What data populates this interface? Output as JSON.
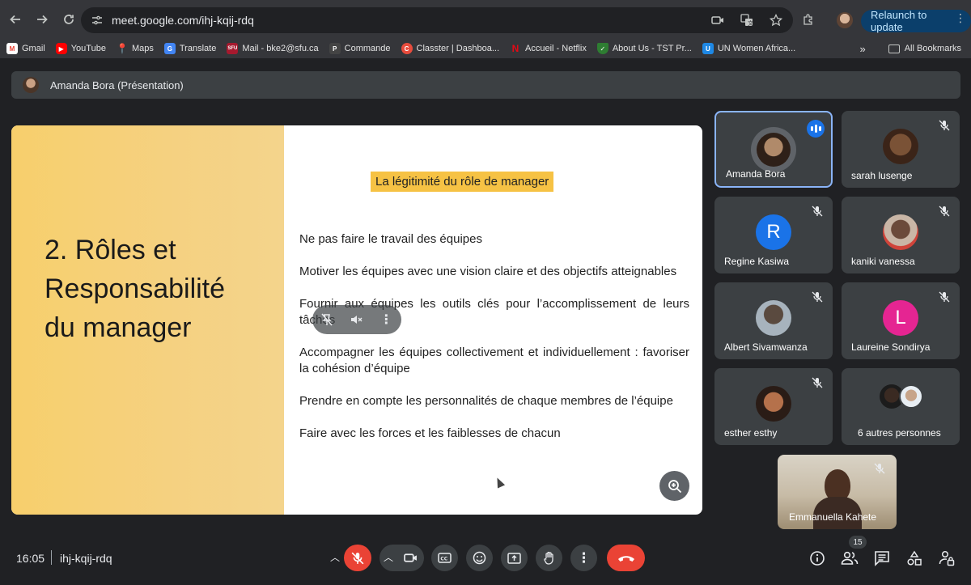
{
  "browser": {
    "url": "meet.google.com/ihj-kqij-rdq",
    "relaunch_label": "Relaunch to update",
    "bookmarks": [
      {
        "label": "Gmail",
        "icon": "gmail-icon",
        "color": "#ea4335"
      },
      {
        "label": "YouTube",
        "icon": "youtube-icon",
        "color": "#ff0000"
      },
      {
        "label": "Maps",
        "icon": "maps-icon",
        "color": "#34a853"
      },
      {
        "label": "Translate",
        "icon": "translate-icon",
        "color": "#4285f4"
      },
      {
        "label": "Mail - bke2@sfu.ca",
        "icon": "sfu-icon",
        "color": "#a6192e"
      },
      {
        "label": "Commande",
        "icon": "p-icon",
        "color": "#555555"
      },
      {
        "label": "Classter | Dashboa...",
        "icon": "classter-icon",
        "color": "#e84c3d"
      },
      {
        "label": "Accueil - Netflix",
        "icon": "netflix-icon",
        "color": "#e50914"
      },
      {
        "label": "About Us - TST Pr...",
        "icon": "shield-icon",
        "color": "#2e7d32"
      },
      {
        "label": "UN Women Africa...",
        "icon": "unwomen-icon",
        "color": "#1e88e5"
      }
    ],
    "all_bookmarks_label": "All Bookmarks"
  },
  "meet": {
    "presenter_label": "Amanda Bora (Présentation)",
    "meeting_time": "16:05",
    "meeting_code": "ihj-kqij-rdq",
    "participant_count": "15",
    "slide": {
      "heading_line1": "2. Rôles et",
      "heading_line2": "Responsabilité",
      "heading_line3": "du manager",
      "subtitle": "La légitimité du rôle de manager",
      "bullets": [
        "Ne pas faire le travail des équipes",
        "Motiver les équipes avec une vision claire et des objectifs atteignables",
        "Fournir aux équipes les outils clés pour l’accomplissement de leurs tâches",
        "Accompagner les équipes collectivement et individuellement : favoriser la cohésion d’équipe",
        "Prendre en compte les personnalités de chaque membres de l’équipe",
        "Faire avec les forces et les faiblesses de chacun"
      ]
    },
    "participants": [
      {
        "name": "Amanda Bora",
        "avatar": "photo",
        "speaking": true,
        "color": "#8a6f5c"
      },
      {
        "name": "sarah lusenge",
        "avatar": "photo",
        "speaking": false,
        "color": "#7a5236"
      },
      {
        "name": "Regine Kasiwa",
        "avatar": "letter",
        "letter": "R",
        "speaking": false,
        "color": "#1a73e8"
      },
      {
        "name": "kaniki vanessa",
        "avatar": "photo",
        "speaking": false,
        "color": "#6b4a3a"
      },
      {
        "name": "Albert Sivamwanza",
        "avatar": "photo",
        "speaking": false,
        "color": "#5a4a3f"
      },
      {
        "name": "Laureine Sondirya",
        "avatar": "letter",
        "letter": "L",
        "speaking": false,
        "color": "#e52592"
      },
      {
        "name": "esther esthy",
        "avatar": "photo",
        "speaking": false,
        "color": "#b5714b"
      },
      {
        "name": "6 autres personnes",
        "avatar": "group",
        "speaking": false,
        "color": "#4a4a4a"
      }
    ],
    "self_view_name": "Emmanuella Kahete",
    "accent_color": "#8ab4f8",
    "end_call_color": "#ea4335"
  }
}
